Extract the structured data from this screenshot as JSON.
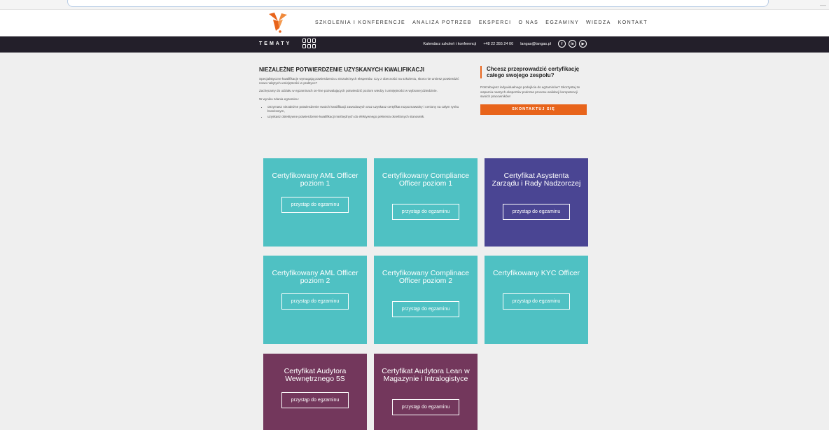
{
  "header": {
    "nav": [
      "SZKOLENIA I KONFERENCJE",
      "ANALIZA POTRZEB",
      "EKSPERCI",
      "O NAS",
      "EGZAMINY",
      "WIEDZA",
      "KONTAKT"
    ]
  },
  "topbar": {
    "topics_label": "TEMATY",
    "calendar_link": "Kalendarz szkoleń i konferencji",
    "phone": "+48 22 355 24 00",
    "email": "langas@langas.pl",
    "social": [
      "f",
      "in",
      "▶"
    ]
  },
  "intro": {
    "title": "NIEZALEŻNE POTWIERDZENIE UZYSKANYCH KWALIFIKACJI",
    "p1": "Specjalistyczne kwalifikacje wymagają potwierdzenia u niezależnych ekspertów. Czy z obecności na szkoleniu, skoro nie umiesz potwierdzić nowo nabytych umiejętności w praktyce?",
    "p2": "Zachęcamy do udziału w egzaminach on-line pozwalających potwierdzić poziom wiedzy i umiejętności w wybranej dziedzinie.",
    "p3": "W wyniku zdania egzaminu:",
    "bullets": [
      "otrzymasz niezależne potwierdzenie swoich kwalifikacji zawodowych oraz uzyskasz certyfikat rozpoznawalny i ceniony na całym rynku branżowym,",
      "uzyskasz obiektywne potwierdzenie kwalifikacji niezbędnych do efektywnego pełnienia określonych stanowisk."
    ]
  },
  "cta": {
    "title": "Chcesz przeprowadzić certyfikację całego swojego zespołu?",
    "text": "Potrzebujesz indywidualnego podejścia do egzaminów? Skorzystaj ze wsparcia naszych ekspertów podczas procesu walidacji kompetencji swoich pracowników!",
    "button": "SKONTAKTUJ SIĘ"
  },
  "exam_button_label": "przystąp do egzaminu",
  "colors": {
    "teal": "#4fc1c3",
    "indigo": "#4a4593",
    "plum": "#73375c",
    "orange": "#e8641b",
    "topbar": "#231f2a"
  },
  "cards": [
    {
      "title": "Certyfikowany AML Officer poziom 1",
      "color": "teal"
    },
    {
      "title": "Certyfikowany Compliance Officer poziom 1",
      "color": "teal"
    },
    {
      "title": "Certyfikat Asystenta Zarządu i Rady Nadzorczej",
      "color": "indigo"
    },
    {
      "title": "Certyfikowany AML Officer poziom 2",
      "color": "teal"
    },
    {
      "title": "Certyfikowany Complinace Officer poziom 2",
      "color": "teal"
    },
    {
      "title": "Certyfikowany KYC Officer",
      "color": "teal"
    },
    {
      "title": "Certyfikat Audytora Wewnętrznego 5S",
      "color": "plum"
    },
    {
      "title": "Certyfikat Audytora Lean w Magazynie i Intralogistyce",
      "color": "plum"
    }
  ]
}
